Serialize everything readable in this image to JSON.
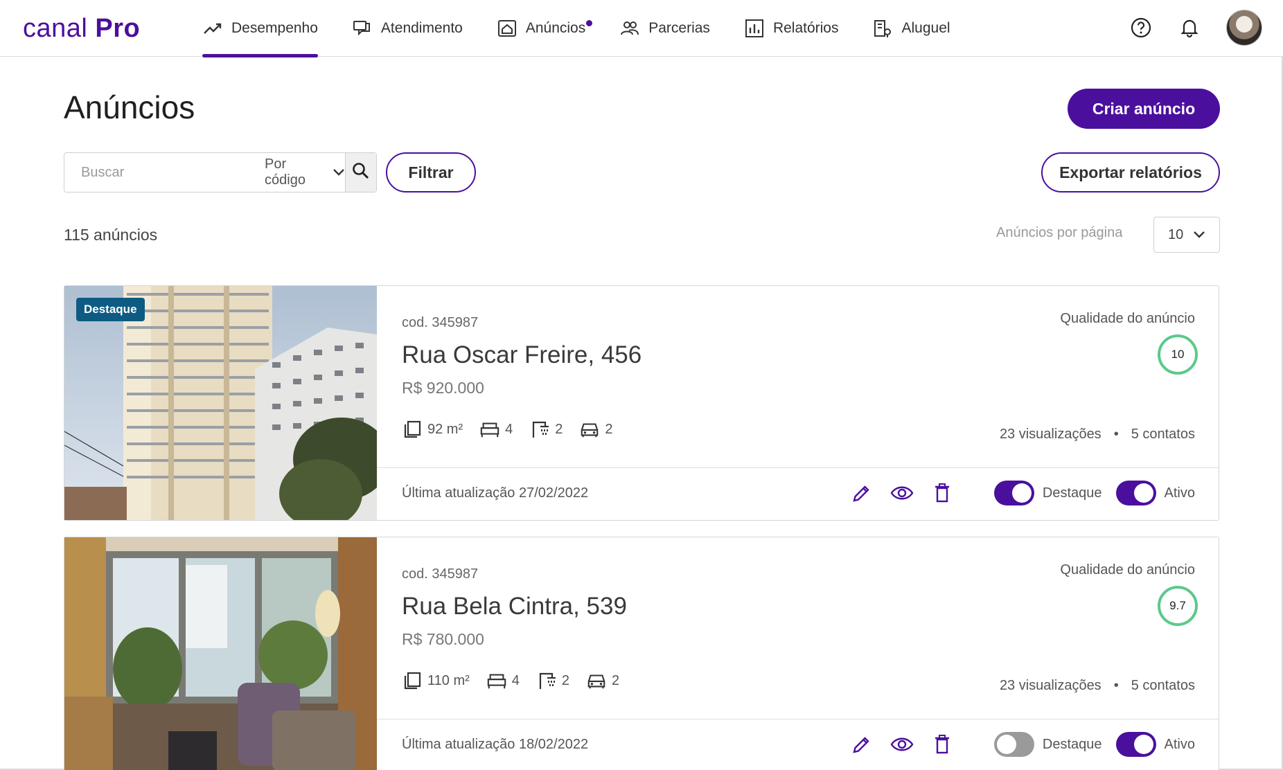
{
  "brand": {
    "name_prefix": "canal",
    "name_suffix": "Pro"
  },
  "nav": [
    {
      "label": "Desempenho",
      "icon": "trending-up-icon",
      "active": true
    },
    {
      "label": "Atendimento",
      "icon": "chat-icon",
      "active": false
    },
    {
      "label": "Anúncios",
      "icon": "house-listing-icon",
      "active": false,
      "notification_dot": true
    },
    {
      "label": "Parcerias",
      "icon": "people-icon",
      "active": false
    },
    {
      "label": "Relatórios",
      "icon": "bar-chart-icon",
      "active": false
    },
    {
      "label": "Aluguel",
      "icon": "building-key-icon",
      "active": false
    }
  ],
  "header_icons": [
    "help-icon",
    "bell-icon",
    "avatar"
  ],
  "page": {
    "title": "Anúncios",
    "create_label": "Criar anúncio",
    "export_label": "Exportar relatórios",
    "filter_label": "Filtrar",
    "search_placeholder": "Buscar",
    "search_by": "Por código",
    "count_text": "115 anúncios",
    "per_page_label": "Anúncios por página",
    "per_page_value": "10"
  },
  "listings": [
    {
      "badge": "Destaque",
      "code": "cod. 345987",
      "address": "Rua Oscar Freire, 456",
      "price": "R$ 920.000",
      "area": "92 m²",
      "bedrooms": "4",
      "bathrooms": "2",
      "parking": "2",
      "quality_label": "Qualidade do anúncio",
      "quality_score": "10",
      "views": "23 visualizações",
      "contacts": "5 contatos",
      "updated": "Última atualização 27/02/2022",
      "destaque_label": "Destaque",
      "destaque_on": true,
      "ativo_label": "Ativo",
      "ativo_on": true
    },
    {
      "badge": "",
      "code": "cod. 345987",
      "address": "Rua Bela Cintra, 539",
      "price": "R$ 780.000",
      "area": "110 m²",
      "bedrooms": "4",
      "bathrooms": "2",
      "parking": "2",
      "quality_label": "Qualidade do anúncio",
      "quality_score": "9.7",
      "views": "23 visualizações",
      "contacts": "5 contatos",
      "updated": "Última atualização 18/02/2022",
      "destaque_label": "Destaque",
      "destaque_on": false,
      "ativo_label": "Ativo",
      "ativo_on": true
    }
  ],
  "colors": {
    "brand": "#4b0f9e",
    "badge": "#0d5b82",
    "quality_ring": "#5cc98a",
    "toggle_off": "#9a9a9a"
  }
}
